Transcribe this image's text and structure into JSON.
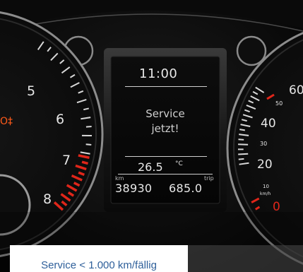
{
  "display": {
    "time": "11:00",
    "message_line1": "Service",
    "message_line2": "jetzt!",
    "temperature": "26.5",
    "temperature_unit": "°C",
    "odometer_unit": "km",
    "odometer": "38930",
    "trip_label": "trip",
    "trip": "685.0"
  },
  "tachometer": {
    "labels": [
      "5",
      "6",
      "7",
      "8"
    ],
    "warning_label": "O‡"
  },
  "speedometer": {
    "labels": [
      "60",
      "50",
      "40",
      "30",
      "20",
      "10",
      "0"
    ],
    "unit": "km/h"
  },
  "caption": {
    "text": "Service < 1.000 km/fällig"
  },
  "colors": {
    "accent_red": "#e0261a",
    "caption_blue": "#2e5f9a"
  }
}
